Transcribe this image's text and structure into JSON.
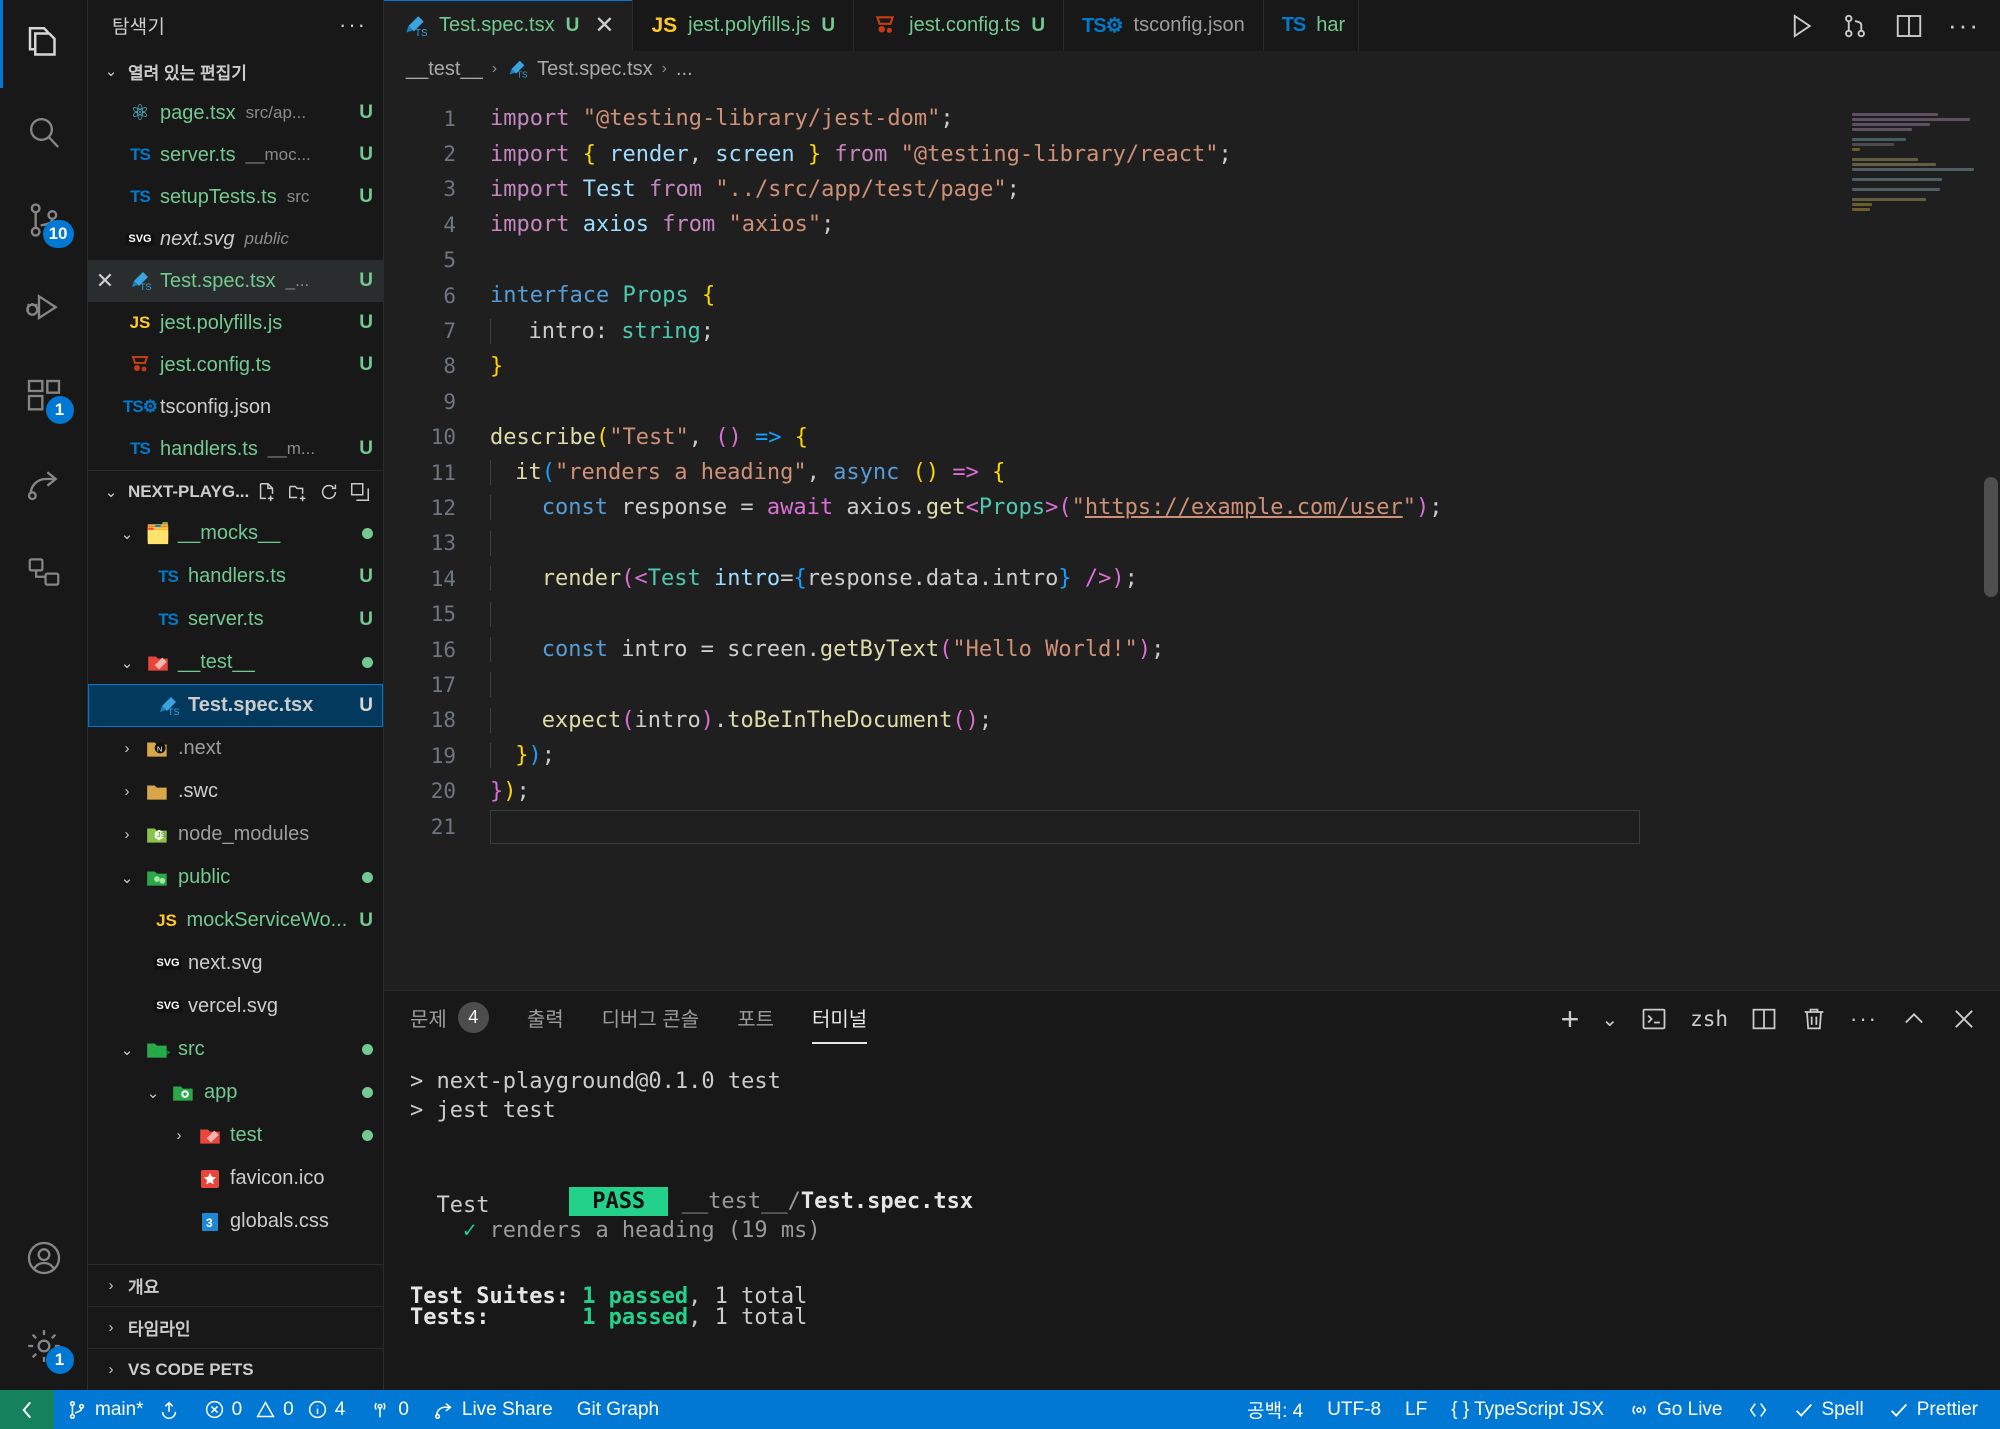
{
  "activitybar": {
    "items": [
      {
        "name": "explorer",
        "icon": "files-icon",
        "badge": null,
        "active": true
      },
      {
        "name": "search",
        "icon": "search-icon",
        "badge": null,
        "active": false
      },
      {
        "name": "source-control",
        "icon": "source-control-icon",
        "badge": "10",
        "active": false
      },
      {
        "name": "run-and-debug",
        "icon": "run-debug-icon",
        "badge": null,
        "active": false
      },
      {
        "name": "extensions",
        "icon": "extensions-icon",
        "badge": "1",
        "active": false
      },
      {
        "name": "live-share",
        "icon": "live-share-icon",
        "badge": null,
        "active": false
      },
      {
        "name": "remote-explorer",
        "icon": "remote-explorer-icon",
        "badge": null,
        "active": false
      }
    ],
    "bottom": [
      {
        "name": "accounts",
        "icon": "account-icon",
        "badge": null
      },
      {
        "name": "settings",
        "icon": "gear-icon",
        "badge": "1"
      }
    ]
  },
  "sidebar": {
    "title": "탐색기",
    "more_actions": "···",
    "open_editors": {
      "label": "열려 있는 편집기",
      "items": [
        {
          "icon": "react-icon",
          "name": "page.tsx",
          "desc": "src/ap...",
          "badge": "U",
          "name_color": "green",
          "selected": false,
          "close": false
        },
        {
          "icon": "ts-icon",
          "name": "server.ts",
          "desc": "__moc...",
          "badge": "U",
          "name_color": "green",
          "selected": false,
          "close": false
        },
        {
          "icon": "ts-icon",
          "name": "setupTests.ts",
          "desc": "src",
          "badge": "U",
          "name_color": "green",
          "selected": false,
          "close": false
        },
        {
          "icon": "svg-icon",
          "name": "next.svg",
          "desc": "public",
          "badge": "",
          "name_color": "white-italic",
          "selected": false,
          "close": false
        },
        {
          "icon": "testtube-icon",
          "name": "Test.spec.tsx",
          "desc": "_...",
          "badge": "U",
          "name_color": "green",
          "selected": true,
          "close": true
        },
        {
          "icon": "js-icon",
          "name": "jest.polyfills.js",
          "desc": "",
          "badge": "U",
          "name_color": "green",
          "selected": false,
          "close": false
        },
        {
          "icon": "jest-icon",
          "name": "jest.config.ts",
          "desc": "",
          "badge": "U",
          "name_color": "green",
          "selected": false,
          "close": false
        },
        {
          "icon": "tsconfig-icon",
          "name": "tsconfig.json",
          "desc": "",
          "badge": "",
          "name_color": "white",
          "selected": false,
          "close": false
        },
        {
          "icon": "ts-icon",
          "name": "handlers.ts",
          "desc": "__m...",
          "badge": "U",
          "name_color": "green",
          "selected": false,
          "close": false
        }
      ]
    },
    "project": {
      "label": "NEXT-PLAYG...",
      "actions": [
        "new-file-icon",
        "new-folder-icon",
        "refresh-icon",
        "collapse-all-icon"
      ],
      "items": [
        {
          "depth": 1,
          "twisty": "v",
          "icon": "folder-mocks",
          "name": "__mocks__",
          "color": "green",
          "dot": true
        },
        {
          "depth": 2,
          "twisty": "",
          "icon": "ts-icon",
          "name": "handlers.ts",
          "color": "green",
          "badge": "U"
        },
        {
          "depth": 2,
          "twisty": "",
          "icon": "ts-icon",
          "name": "server.ts",
          "color": "green",
          "badge": "U"
        },
        {
          "depth": 1,
          "twisty": "v",
          "icon": "folder-test-red",
          "name": "__test__",
          "color": "green",
          "dot": true
        },
        {
          "depth": 2,
          "twisty": "",
          "icon": "testtube-icon",
          "name": "Test.spec.tsx",
          "color": "white",
          "badge": "U",
          "selected": true
        },
        {
          "depth": 1,
          "twisty": ">",
          "icon": "folder-next",
          "name": ".next",
          "color": "grey"
        },
        {
          "depth": 1,
          "twisty": ">",
          "icon": "folder-plain",
          "name": ".swc",
          "color": "white"
        },
        {
          "depth": 1,
          "twisty": ">",
          "icon": "folder-node",
          "name": "node_modules",
          "color": "grey"
        },
        {
          "depth": 1,
          "twisty": "v",
          "icon": "folder-public",
          "name": "public",
          "color": "green",
          "dot": true
        },
        {
          "depth": 2,
          "twisty": "",
          "icon": "js-icon",
          "name": "mockServiceWo...",
          "color": "green",
          "badge": "U"
        },
        {
          "depth": 2,
          "twisty": "",
          "icon": "svg-icon",
          "name": "next.svg",
          "color": "white"
        },
        {
          "depth": 2,
          "twisty": "",
          "icon": "svg-icon",
          "name": "vercel.svg",
          "color": "white"
        },
        {
          "depth": 1,
          "twisty": "v",
          "icon": "folder-src",
          "name": "src",
          "color": "green",
          "dot": true
        },
        {
          "depth": 2,
          "twisty": "v",
          "icon": "folder-app",
          "name": "app",
          "color": "green",
          "dot": true
        },
        {
          "depth": 3,
          "twisty": ">",
          "icon": "folder-test-red",
          "name": "test",
          "color": "green",
          "dot": true
        },
        {
          "depth": 3,
          "twisty": "",
          "icon": "favicon-icon",
          "name": "favicon.ico",
          "color": "white"
        },
        {
          "depth": 3,
          "twisty": "",
          "icon": "css-icon",
          "name": "globals.css",
          "color": "white"
        }
      ]
    },
    "collapsed_sections": [
      {
        "label": "개요"
      },
      {
        "label": "타임라인"
      },
      {
        "label": "VS CODE PETS"
      }
    ]
  },
  "tabs": [
    {
      "icon": "testtube-icon",
      "label": "Test.spec.tsx",
      "modified": "U",
      "active": true,
      "closable": true,
      "color": "green"
    },
    {
      "icon": "js-icon",
      "label": "jest.polyfills.js",
      "modified": "U",
      "active": false,
      "closable": false,
      "color": "green"
    },
    {
      "icon": "jest-icon",
      "label": "jest.config.ts",
      "modified": "U",
      "active": false,
      "closable": false,
      "color": "green"
    },
    {
      "icon": "tsconfig-icon",
      "label": "tsconfig.json",
      "modified": "",
      "active": false,
      "closable": false,
      "color": "grey"
    },
    {
      "icon": "ts-icon",
      "label": "har",
      "modified": "",
      "active": false,
      "closable": false,
      "color": "green"
    }
  ],
  "tab_actions": [
    "run-icon",
    "split-source-control-icon",
    "split-editor-icon",
    "more-actions-icon"
  ],
  "breadcrumb": [
    "__test__",
    "Test.spec.tsx",
    "..."
  ],
  "code": {
    "lines": [
      {
        "n": 1,
        "text": "import \"@testing-library/jest-dom\";"
      },
      {
        "n": 2,
        "text": "import { render, screen } from \"@testing-library/react\";"
      },
      {
        "n": 3,
        "text": "import Test from \"../src/app/test/page\";"
      },
      {
        "n": 4,
        "text": "import axios from \"axios\";"
      },
      {
        "n": 5,
        "text": ""
      },
      {
        "n": 6,
        "text": "interface Props {"
      },
      {
        "n": 7,
        "text": "  intro: string;"
      },
      {
        "n": 8,
        "text": "}"
      },
      {
        "n": 9,
        "text": ""
      },
      {
        "n": 10,
        "text": "describe(\"Test\", () => {"
      },
      {
        "n": 11,
        "text": "  it(\"renders a heading\", async () => {"
      },
      {
        "n": 12,
        "text": "    const response = await axios.get<Props>(\"https://example.com/user\");"
      },
      {
        "n": 13,
        "text": ""
      },
      {
        "n": 14,
        "text": "    render(<Test intro={response.data.intro} />);"
      },
      {
        "n": 15,
        "text": ""
      },
      {
        "n": 16,
        "text": "    const intro = screen.getByText(\"Hello World!\");"
      },
      {
        "n": 17,
        "text": ""
      },
      {
        "n": 18,
        "text": "    expect(intro).toBeInTheDocument();"
      },
      {
        "n": 19,
        "text": "  });"
      },
      {
        "n": 20,
        "text": "});"
      },
      {
        "n": 21,
        "text": ""
      }
    ]
  },
  "panel": {
    "tabs": [
      {
        "label": "문제",
        "badge": "4",
        "active": false
      },
      {
        "label": "출력",
        "badge": "",
        "active": false
      },
      {
        "label": "디버그 콘솔",
        "badge": "",
        "active": false
      },
      {
        "label": "포트",
        "badge": "",
        "active": false
      },
      {
        "label": "터미널",
        "badge": "",
        "active": true
      }
    ],
    "actions": {
      "new_terminal": "+",
      "dropdown": "chevron-down-icon",
      "shell_icon": "terminal-icon",
      "shell_name": "zsh",
      "split": "split-terminal-icon",
      "kill": "trash-icon",
      "more": "···",
      "maximize": "chevron-up-icon",
      "close": "close-icon"
    },
    "terminal_lines": [
      {
        "segments": [
          {
            "t": "> next-playground@0.1.0 test",
            "c": "plain"
          }
        ]
      },
      {
        "segments": [
          {
            "t": "> jest test",
            "c": "plain"
          }
        ]
      },
      {
        "segments": [
          {
            "t": "",
            "c": "plain"
          }
        ]
      },
      {
        "segments": [
          {
            "t": " PASS ",
            "c": "pass"
          },
          {
            "t": " ",
            "c": "plain"
          },
          {
            "t": "__test__/",
            "c": "dim"
          },
          {
            "t": "Test.spec.tsx",
            "c": "bold"
          }
        ]
      },
      {
        "segments": [
          {
            "t": "  Test",
            "c": "plain"
          }
        ]
      },
      {
        "segments": [
          {
            "t": "    ✓ ",
            "c": "check"
          },
          {
            "t": "renders a heading (19 ms)",
            "c": "dim"
          }
        ]
      },
      {
        "segments": [
          {
            "t": "",
            "c": "plain"
          }
        ]
      },
      {
        "segments": [
          {
            "t": "Test Suites: ",
            "c": "bold"
          },
          {
            "t": "1 passed",
            "c": "greenbold"
          },
          {
            "t": ", 1 total",
            "c": "plain"
          }
        ]
      },
      {
        "segments": [
          {
            "t": "Tests:       ",
            "c": "bold"
          },
          {
            "t": "1 passed",
            "c": "greenbold"
          },
          {
            "t": ", 1 total",
            "c": "plain"
          }
        ]
      }
    ]
  },
  "statusbar": {
    "remote_icon": "remote-icon",
    "left": [
      {
        "name": "branch",
        "icon": "git-branch-icon",
        "label": "main*"
      },
      {
        "name": "sync",
        "icon": "sync-icon",
        "label": ""
      },
      {
        "name": "problems",
        "icon": "error-warn-info-icons",
        "label": "0  0  4",
        "errors": "0",
        "warnings": "0",
        "infos": "4"
      },
      {
        "name": "radio-tower",
        "icon": "radio-tower-icon",
        "label": "0"
      },
      {
        "name": "live-share",
        "icon": "live-share-icon",
        "label": "Live Share"
      },
      {
        "name": "git-graph",
        "icon": "",
        "label": "Git Graph"
      }
    ],
    "right": [
      {
        "name": "indent",
        "label": "공백: 4"
      },
      {
        "name": "encoding",
        "label": "UTF-8"
      },
      {
        "name": "eol",
        "label": "LF"
      },
      {
        "name": "language",
        "label": "{ } TypeScript JSX"
      },
      {
        "name": "go-live",
        "icon": "broadcast-icon",
        "label": "Go Live"
      },
      {
        "name": "remote-indicator",
        "icon": "remote-icon",
        "label": ""
      },
      {
        "name": "spell",
        "icon": "check-icon",
        "label": "Spell"
      },
      {
        "name": "prettier",
        "icon": "check-icon",
        "label": "Prettier"
      }
    ]
  },
  "colors": {
    "accent": "#0078d4",
    "green_badge": "#73c991",
    "pass_green": "#23d18b",
    "remote_green": "#16825d",
    "editor_bg": "#1f1f1f",
    "sidebar_bg": "#181818"
  }
}
